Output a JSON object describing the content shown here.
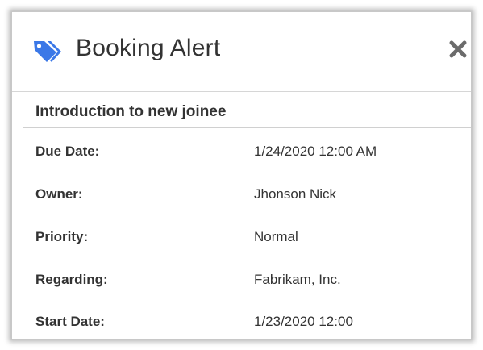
{
  "dialog": {
    "title": "Booking Alert",
    "title_icon": "tag-icon",
    "close_icon": "close-icon",
    "accent_color": "#3b78e7"
  },
  "section": {
    "title": "Introduction to new joinee"
  },
  "fields": [
    {
      "label": "Due Date:",
      "value": "1/24/2020 12:00 AM"
    },
    {
      "label": "Owner:",
      "value": "Jhonson Nick"
    },
    {
      "label": "Priority:",
      "value": "Normal"
    },
    {
      "label": "Regarding:",
      "value": "Fabrikam, Inc."
    },
    {
      "label": "Start Date:",
      "value": "1/23/2020 12:00"
    }
  ]
}
